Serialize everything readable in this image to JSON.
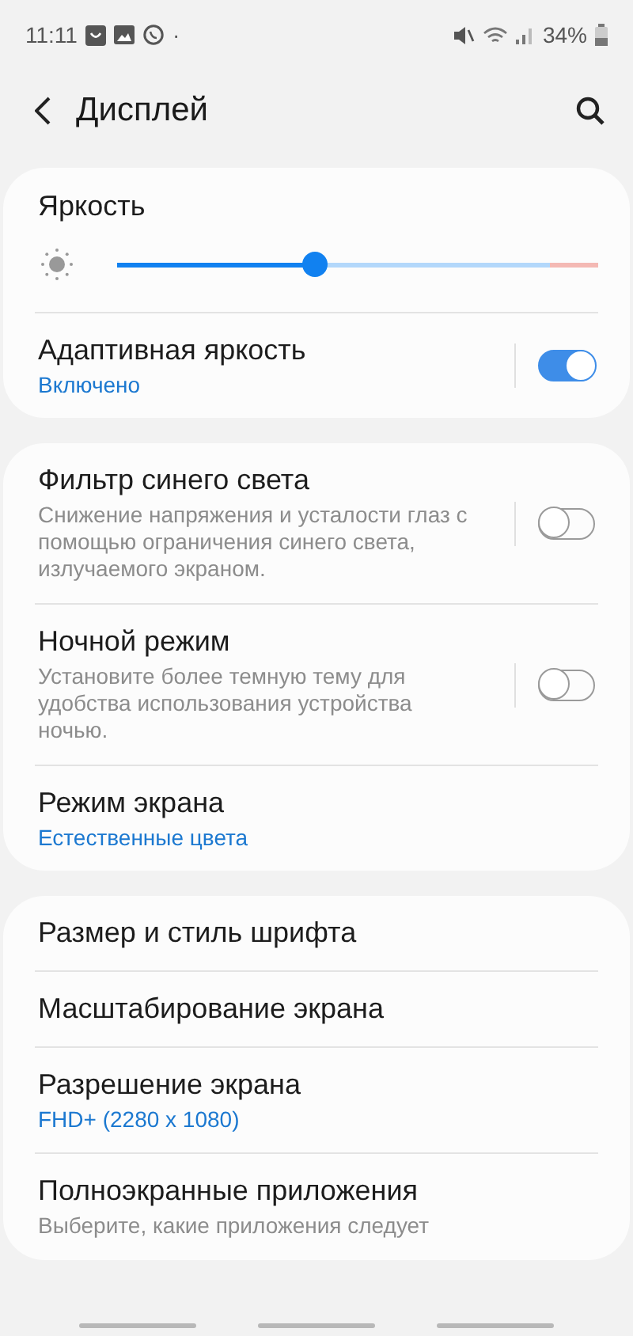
{
  "status_bar": {
    "time": "11:11",
    "dot": "·",
    "battery_text": "34%"
  },
  "header": {
    "title": "Дисплей"
  },
  "cards": [
    {
      "items": [
        {
          "kind": "slider",
          "title": "Яркость",
          "level": 0.41
        },
        {
          "kind": "switch",
          "title": "Адаптивная яркость",
          "status": "Включено",
          "on": true
        }
      ]
    },
    {
      "items": [
        {
          "kind": "switch",
          "title": "Фильтр синего света",
          "description": "Снижение напряжения и усталости глаз с помощью ограничения синего света, излучаемого экраном.",
          "on": false
        },
        {
          "kind": "switch",
          "title": "Ночной режим",
          "description": "Установите более темную тему для удобства использования устройства ночью.",
          "on": false
        },
        {
          "kind": "link",
          "title": "Режим экрана",
          "status": "Естественные цвета"
        }
      ]
    },
    {
      "items": [
        {
          "kind": "link",
          "title": "Размер и стиль шрифта"
        },
        {
          "kind": "link",
          "title": "Масштабирование экрана"
        },
        {
          "kind": "link",
          "title": "Разрешение экрана",
          "status": "FHD+ (2280 x 1080)"
        },
        {
          "kind": "link",
          "title": "Полноэкранные приложения",
          "description": "Выберите, какие приложения следует"
        }
      ]
    }
  ]
}
